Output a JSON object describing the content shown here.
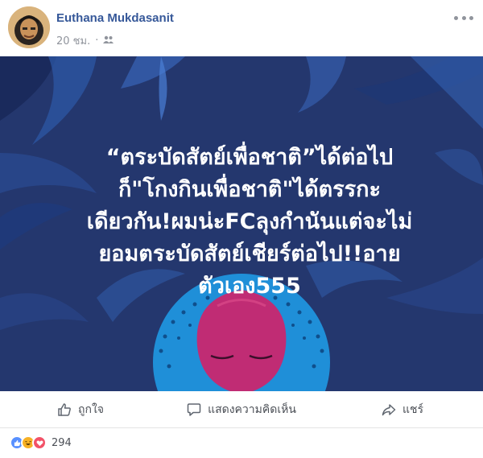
{
  "post": {
    "author": "Euthana Mukdasanit",
    "time": "20 ชม.",
    "privacy_icon": "friends-icon",
    "text_lines": [
      "“ตระบัดสัตย์เพื่อชาติ”ได้ต่อไป",
      "ก็\"โกงกินเพื่อชาติ\"ได้ตรรกะ",
      "เดียวกัน!ผมน่ะFCลุงกำนันแต่จะไม่",
      "ยอมตระบัดสัตย์เชียร์ต่อไป!!อาย",
      "ตัวเอง555"
    ],
    "background_color": "#24376e"
  },
  "actions": {
    "like": "ถูกใจ",
    "comment": "แสดงความคิดเห็น",
    "share": "แชร์"
  },
  "reactions": {
    "count": "294",
    "types": [
      "like-icon",
      "haha-icon",
      "love-icon"
    ]
  },
  "colors": {
    "author": "#365899",
    "meta": "#90949c",
    "action_text": "#4b4f56"
  }
}
